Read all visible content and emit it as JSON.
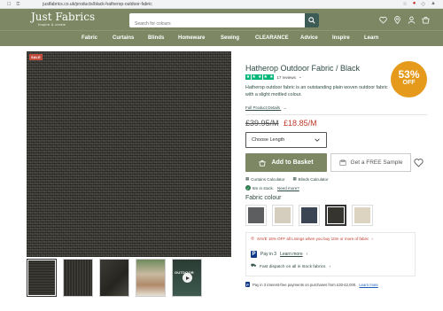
{
  "browser": {
    "url": "justfabrics.co.uk/products/black-hatherop-outdoor-fabric"
  },
  "header": {
    "logo": "Just Fabrics",
    "tagline": "Inspire & create",
    "search_placeholder": "Search for colours",
    "icons": [
      "heart-icon",
      "location-icon",
      "user-icon",
      "basket-icon"
    ]
  },
  "nav": {
    "items": [
      "Fabric",
      "Curtains",
      "Blinds",
      "Homeware",
      "Sewing",
      "CLEARANCE",
      "Advice",
      "Inspire",
      "Learn"
    ]
  },
  "gallery": {
    "sale_badge": "SALE",
    "video_label": "OUTDOOR"
  },
  "product": {
    "title": "Hatherop Outdoor Fabric / Black",
    "rating": 5,
    "reviews": "17 reviews",
    "description": "Hatherop outdoor fabric is an outstanding plain woven outdoor fabric with a slight mottled colour.",
    "details_link": "Full Product Details",
    "discount_pct": "53%",
    "discount_off": "OFF",
    "price_old": "£39.95/M",
    "price_new": "£18.85/M",
    "length_select": "Choose Length",
    "add_to_basket": "Add to Basket",
    "free_sample": "Get a FREE Sample",
    "curtains_calc": "Curtains Calculator",
    "blinds_calc": "Blinds Calculator",
    "stock_text": "8m in stock.",
    "need_more": "Need more?",
    "colour_label": "Fabric colour",
    "swatches": [
      {
        "name": "grey",
        "color": "#5c5e5f"
      },
      {
        "name": "beige",
        "color": "#d5cdbd"
      },
      {
        "name": "navy",
        "color": "#3b4452"
      },
      {
        "name": "black",
        "color": "#35342f"
      },
      {
        "name": "natural",
        "color": "#dcd3c1"
      }
    ],
    "promo": "SAVE 15% OFF all Linings when you buy 10m or more of fabric",
    "pay_in_3": "Pay in 3",
    "learn_more": "Learn more",
    "dispatch": "Fast dispatch on all in stock fabrics",
    "paypal_note": "Pay in 3 interest-free payments on purchases from £30-£2,000.",
    "paypal_learn": "Learn more"
  },
  "colors": {
    "brand_green": "#7d8763",
    "dark_teal": "#2f4b45",
    "sale_red": "#c0392b",
    "discount_orange": "#e59a1b"
  }
}
